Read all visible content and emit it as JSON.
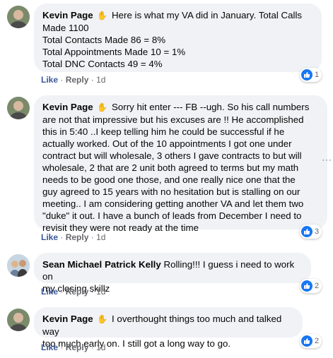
{
  "comments": [
    {
      "name": "Kevin Page",
      "lines": [
        "Here is what my VA did in January. Total Calls",
        "Made 1100",
        "Total Contacts Made 86 = 8%",
        "Total Appointments Made 10 = 1%",
        "Total DNC Contacts 49 = 4%"
      ],
      "like": "Like",
      "reply": "Reply",
      "time": "1d",
      "reactions": "1"
    },
    {
      "name": "Kevin Page",
      "lines": [
        "Sorry hit enter --- FB --ugh. So his call numbers",
        "are not that impressive but his excuses are !! He accomplished",
        "this in 5:40 ..I keep telling him he could be successful if he",
        "actually worked. Out of the 10 appointments I got one under",
        "contract but will wholesale, 3 others I gave contracts to but will",
        "wholesale, 2 that are 2 unit both agreed to terms but my math",
        "needs to be good one those, and one really nice one that the",
        "guy agreed to 15 years with no hesitation but is stalling on our",
        "meeting.. I am considering getting another VA and let them two",
        "\"duke\" it out. I have a bunch of leads from December I need to",
        "revisit they were not ready at the time"
      ],
      "like": "Like",
      "reply": "Reply",
      "time": "1d",
      "reactions": "3"
    },
    {
      "name": "Sean Michael Patrick Kelly",
      "lines": [
        "Rolling!!! I guess i need to work on",
        "my closing skillz"
      ],
      "like": "Like",
      "reply": "Reply",
      "time": "1d",
      "reactions": "2"
    },
    {
      "name": "Kevin Page",
      "lines": [
        "I overthought things too much and talked way",
        "too much early on. I still got a long way to go."
      ],
      "like": "Like",
      "reply": "Reply",
      "time": "1d",
      "reactions": "2"
    }
  ],
  "separator": "·",
  "icons": {
    "wave": "waving-hand-icon",
    "thumb": "thumbs-up-icon",
    "avatar": "profile-avatar-icon"
  },
  "colors": {
    "like_link": "#385898",
    "bubble": "#f0f2f5",
    "reaction": "#1877f2"
  }
}
